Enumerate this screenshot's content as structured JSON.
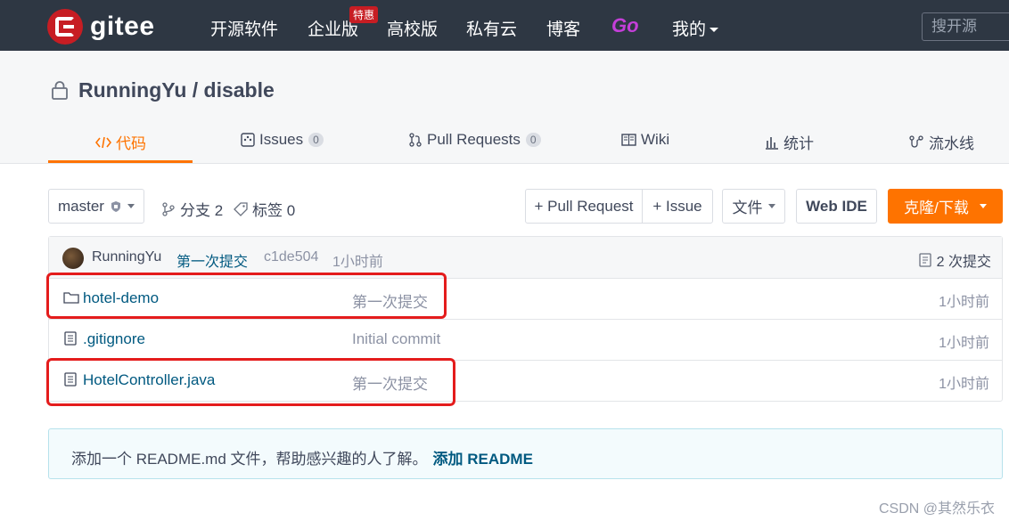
{
  "nav": {
    "logo_text": "gitee",
    "items": [
      "开源软件",
      "企业版",
      "高校版",
      "私有云",
      "博客"
    ],
    "badge": "特惠",
    "go_label": "Go",
    "mine_label": "我的",
    "search_placeholder": "搜开源"
  },
  "repo": {
    "title": "RunningYu / disable"
  },
  "tabs": {
    "code": "代码",
    "issues": "Issues",
    "issues_count": "0",
    "pulls": "Pull Requests",
    "pulls_count": "0",
    "wiki": "Wiki",
    "stats": "统计",
    "pipeline": "流水线"
  },
  "toolbar": {
    "branch": "master",
    "branches_label": "分支 2",
    "tags_label": "标签 0",
    "pull_request_btn": "+ Pull Request",
    "issue_btn": "+ Issue",
    "file_btn": "文件",
    "webide_btn": "Web IDE",
    "clone_btn": "克隆/下载"
  },
  "commit": {
    "author": "RunningYu",
    "message": "第一次提交",
    "hash": "c1de504",
    "time": "1小时前",
    "total": "2 次提交"
  },
  "files": [
    {
      "name": "hotel-demo",
      "message": "第一次提交",
      "time": "1小时前",
      "icon": "folder-icon"
    },
    {
      "name": ".gitignore",
      "message": "Initial commit",
      "time": "1小时前",
      "icon": "file-icon"
    },
    {
      "name": "HotelController.java",
      "message": "第一次提交",
      "time": "1小时前",
      "icon": "file-icon"
    }
  ],
  "readme": {
    "text": "添加一个 README.md 文件，帮助感兴趣的人了解。",
    "link": "添加 README"
  },
  "watermark": "CSDN @其然乐衣",
  "colors": {
    "nav_bg": "#2e3743",
    "accent": "#fe7300",
    "link": "#005980",
    "highlight": "#e41c1c"
  }
}
